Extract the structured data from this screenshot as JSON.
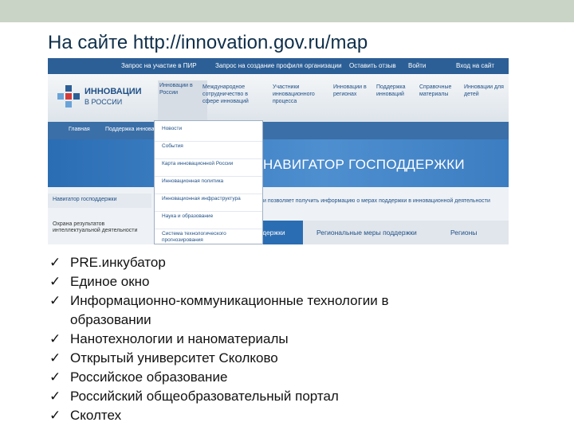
{
  "slide": {
    "title": "На сайте http://innovation.gov.ru/map"
  },
  "screenshot": {
    "top_links": [
      "Запрос на участие в ПИР",
      "Запрос на создание профиля организации",
      "Оставить отзыв",
      "Войти",
      "Вход на сайт"
    ],
    "logo_line1": "ИННОВАЦИИ",
    "logo_line2": "В РОССИИ",
    "nav": [
      "Инновации в России",
      "Международное сотрудничество в сфере инноваций",
      "Участники инновационного процесса",
      "Инновации в регионах",
      "Поддержка инноваций",
      "Справочные материалы",
      "Инновации для детей"
    ],
    "strip": [
      "Главная",
      "Поддержка иннова"
    ],
    "dropdown": [
      "Новости",
      "События",
      "Карта инновационной России",
      "Инновационная политика",
      "Инновационная инфраструктура",
      "Наука и образование",
      "Система технологического прогнозирования"
    ],
    "banner": "НАВИГАТОР ГОСПОДДЕРЖКИ",
    "subnav": "Навигатор господдержки",
    "side_text": "Охрана результатов интеллектуальной деятельности",
    "info": "и позволяет получить информацию о мерах поддержки в инновационной деятельности",
    "tabs": [
      "держки",
      "Региональные меры поддержки",
      "Регионы"
    ],
    "colors": {
      "header_blue": "#2c5f96",
      "accent": "#2b6db3"
    }
  },
  "bullets": {
    "check": "✓",
    "items": [
      "PRE.инкубатор",
      "Единое окно",
      "Информационно-коммуникационные технологии в",
      "образовании",
      "Нанотехнологии и наноматериалы",
      "Открытый университет Сколково",
      "Российское образование",
      "Российский общеобразовательный портал",
      "Сколтех"
    ]
  }
}
